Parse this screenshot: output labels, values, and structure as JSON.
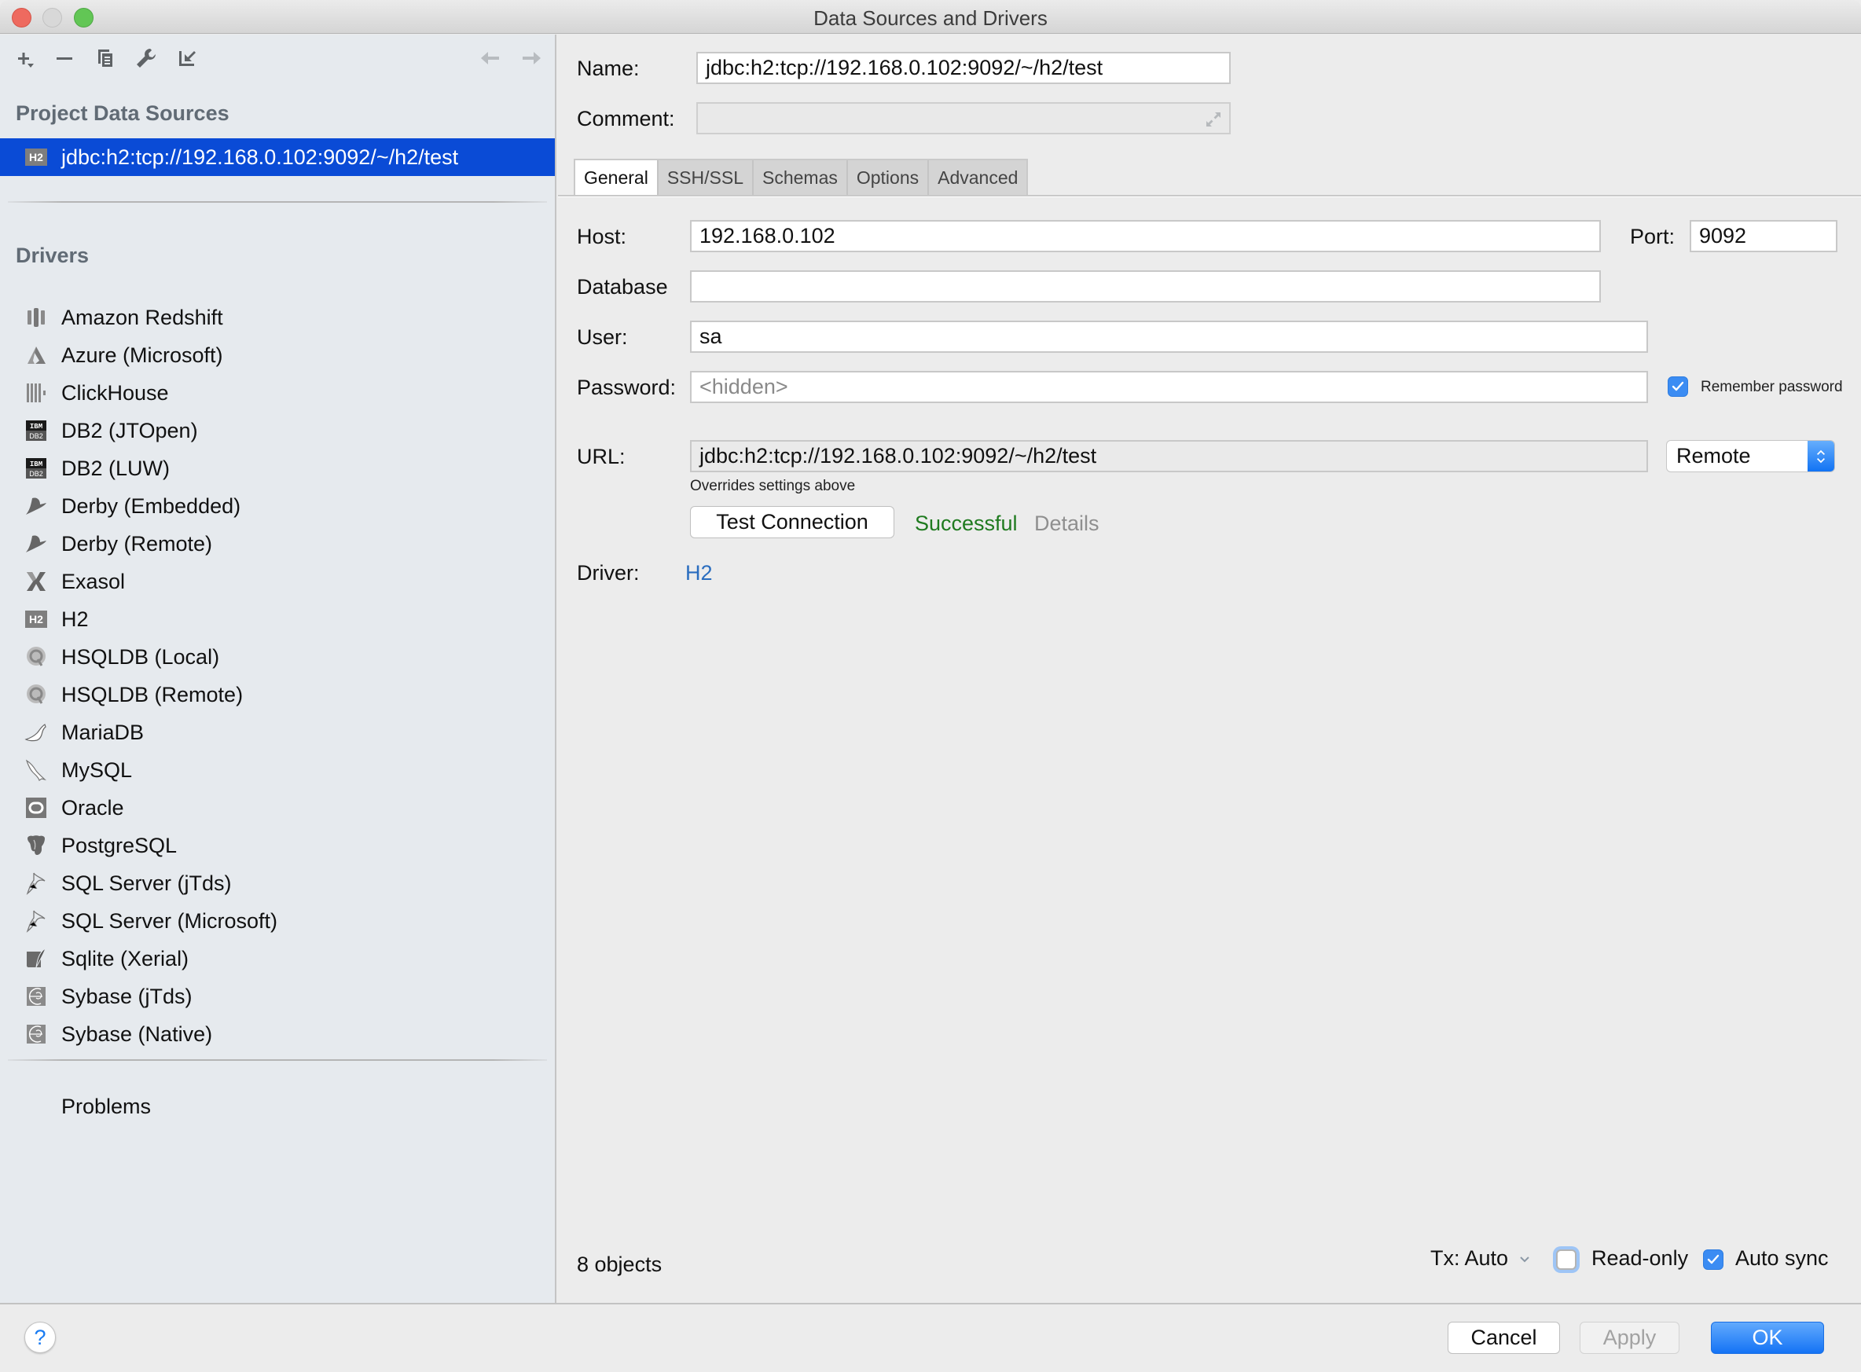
{
  "window": {
    "title": "Data Sources and Drivers"
  },
  "sidebar": {
    "toolbar": {
      "add_icon": "plus-icon",
      "remove_icon": "minus-icon",
      "duplicate_icon": "copy-icon",
      "properties_icon": "wrench-icon",
      "import_icon": "import-arrow-icon",
      "back_icon": "arrow-left-icon",
      "forward_icon": "arrow-right-icon"
    },
    "project_section_title": "Project Data Sources",
    "data_sources": [
      {
        "label": "jdbc:h2:tcp://192.168.0.102:9092/~/h2/test",
        "icon": "H2",
        "selected": true
      }
    ],
    "drivers_section_title": "Drivers",
    "drivers": [
      {
        "label": "Amazon Redshift",
        "icon": "redshift-icon"
      },
      {
        "label": "Azure (Microsoft)",
        "icon": "azure-icon"
      },
      {
        "label": "ClickHouse",
        "icon": "clickhouse-icon"
      },
      {
        "label": "DB2 (JTOpen)",
        "icon": "ibm-db2-icon"
      },
      {
        "label": "DB2 (LUW)",
        "icon": "ibm-db2-icon"
      },
      {
        "label": "Derby (Embedded)",
        "icon": "derby-hat-icon"
      },
      {
        "label": "Derby (Remote)",
        "icon": "derby-hat-icon"
      },
      {
        "label": "Exasol",
        "icon": "exasol-icon"
      },
      {
        "label": "H2",
        "icon": "h2-icon"
      },
      {
        "label": "HSQLDB (Local)",
        "icon": "hsqldb-icon"
      },
      {
        "label": "HSQLDB (Remote)",
        "icon": "hsqldb-icon"
      },
      {
        "label": "MariaDB",
        "icon": "mariadb-seal-icon"
      },
      {
        "label": "MySQL",
        "icon": "mysql-dolphin-icon"
      },
      {
        "label": "Oracle",
        "icon": "oracle-icon"
      },
      {
        "label": "PostgreSQL",
        "icon": "postgresql-elephant-icon"
      },
      {
        "label": "SQL Server (jTds)",
        "icon": "sqlserver-icon"
      },
      {
        "label": "SQL Server (Microsoft)",
        "icon": "sqlserver-icon"
      },
      {
        "label": "Sqlite (Xerial)",
        "icon": "sqlite-feather-icon"
      },
      {
        "label": "Sybase (jTds)",
        "icon": "sybase-icon"
      },
      {
        "label": "Sybase (Native)",
        "icon": "sybase-icon"
      }
    ],
    "problems_label": "Problems"
  },
  "main": {
    "name_label": "Name:",
    "name_value": "jdbc:h2:tcp://192.168.0.102:9092/~/h2/test",
    "comment_label": "Comment:",
    "comment_value": "",
    "tabs": [
      {
        "label": "General",
        "active": true
      },
      {
        "label": "SSH/SSL",
        "active": false
      },
      {
        "label": "Schemas",
        "active": false
      },
      {
        "label": "Options",
        "active": false
      },
      {
        "label": "Advanced",
        "active": false
      }
    ],
    "general": {
      "host_label": "Host:",
      "host_value": "192.168.0.102",
      "port_label": "Port:",
      "port_value": "9092",
      "database_label": "Database",
      "database_value": "",
      "user_label": "User:",
      "user_value": "sa",
      "password_label": "Password:",
      "password_placeholder": "<hidden>",
      "remember_password_label": "Remember password",
      "remember_password_checked": true,
      "url_label": "URL:",
      "url_value": "jdbc:h2:tcp://192.168.0.102:9092/~/h2/test",
      "url_hint": "Overrides settings above",
      "url_mode": "Remote",
      "test_connection_label": "Test Connection",
      "test_status": "Successful",
      "details_label": "Details",
      "driver_label": "Driver:",
      "driver_value": "H2"
    },
    "status_bar": {
      "objects_count": "8 objects",
      "tx_label": "Tx: Auto",
      "read_only_label": "Read-only",
      "read_only_checked": false,
      "auto_sync_label": "Auto sync",
      "auto_sync_checked": true
    }
  },
  "footer": {
    "help_label": "?",
    "cancel_label": "Cancel",
    "apply_label": "Apply",
    "ok_label": "OK"
  },
  "colors": {
    "selection": "#0a4bd6",
    "success": "#1f7a1f",
    "link": "#2a6dbf",
    "primary_button": "#1473f5",
    "checkbox": "#3b8cf3"
  }
}
